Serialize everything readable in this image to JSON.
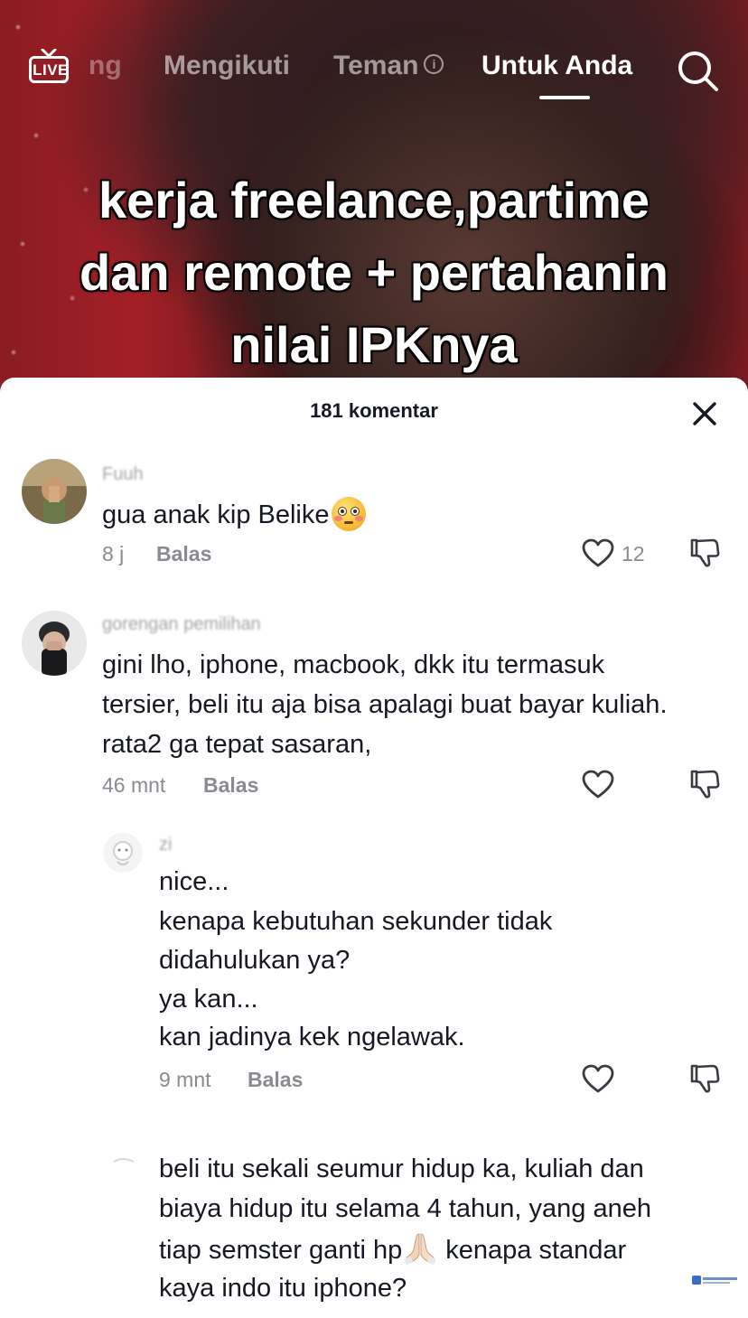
{
  "nav": {
    "live_label": "LIVE",
    "partial_tab_label": "ng",
    "tabs": [
      {
        "label": "Mengikuti"
      },
      {
        "label": "Teman"
      },
      {
        "label": "Untuk Anda"
      }
    ],
    "active_tab": "Untuk Anda"
  },
  "video": {
    "caption_lines": [
      "kerja freelance,partime",
      "dan remote + pertahanin",
      "nilai IPKnya"
    ]
  },
  "comments_panel": {
    "title": "181 komentar",
    "reply_label": "Balas",
    "comments": [
      {
        "username": "Fuuh",
        "lines": [
          "gua anak kip Belike"
        ],
        "time": "8 j",
        "likes": "12"
      },
      {
        "username": "gorengan pemilihan",
        "lines": [
          "gini lho, iphone, macbook, dkk itu termasuk",
          "tersier, beli itu aja bisa apalagi buat bayar kuliah.",
          "rata2 ga tepat sasaran,"
        ],
        "time": "46 mnt"
      }
    ],
    "replies": [
      {
        "username": "zi",
        "lines": [
          "nice...",
          "kenapa kebutuhan sekunder tidak",
          "didahulukan ya?",
          "ya kan...",
          "kan jadinya kek ngelawak."
        ],
        "time": "9 mnt"
      },
      {
        "username": "",
        "lines": [
          "beli itu sekali seumur hidup ka, kuliah dan",
          "biaya hidup itu selama 4 tahun, yang aneh",
          "tiap semster ganti hp",
          " kenapa standar",
          "kaya indo itu iphone?"
        ]
      }
    ]
  },
  "icons": {
    "live": "live-tv-icon",
    "info": "info-icon",
    "search": "search-icon",
    "close": "close-icon",
    "like": "heart-icon",
    "dislike": "thumbs-down-icon"
  },
  "colors": {
    "text_primary": "#161823",
    "text_secondary": "#8a8b91",
    "sheet_bg": "#ffffff"
  }
}
